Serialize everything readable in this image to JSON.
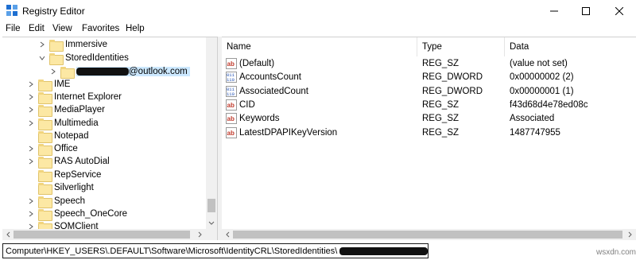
{
  "window": {
    "title": "Registry Editor",
    "minimize_icon": "minimize-icon",
    "maximize_icon": "maximize-icon",
    "close_icon": "close-icon"
  },
  "menu": [
    "File",
    "Edit",
    "View",
    "Favorites",
    "Help"
  ],
  "tree": {
    "items": [
      {
        "label": "Immersive",
        "expander": "collapsed"
      },
      {
        "label": "StoredIdentities",
        "expander": "expanded"
      },
      {
        "label": "@outlook.com",
        "expander": "collapsed",
        "selected": true,
        "redacted_prefix": true
      },
      {
        "label": "IME",
        "expander": "collapsed"
      },
      {
        "label": "Internet Explorer",
        "expander": "collapsed"
      },
      {
        "label": "MediaPlayer",
        "expander": "collapsed"
      },
      {
        "label": "Multimedia",
        "expander": "collapsed"
      },
      {
        "label": "Notepad",
        "expander": "none"
      },
      {
        "label": "Office",
        "expander": "collapsed"
      },
      {
        "label": "RAS AutoDial",
        "expander": "collapsed"
      },
      {
        "label": "RepService",
        "expander": "none"
      },
      {
        "label": "Silverlight",
        "expander": "none"
      },
      {
        "label": "Speech",
        "expander": "collapsed"
      },
      {
        "label": "Speech_OneCore",
        "expander": "collapsed"
      },
      {
        "label": "SQMClient",
        "expander": "collapsed"
      }
    ]
  },
  "values": {
    "headers": [
      "Name",
      "Type",
      "Data"
    ],
    "rows": [
      {
        "icon": "string-value-icon",
        "name": "(Default)",
        "type": "REG_SZ",
        "data": "(value not set)"
      },
      {
        "icon": "dword-value-icon",
        "name": "AccountsCount",
        "type": "REG_DWORD",
        "data": "0x00000002 (2)"
      },
      {
        "icon": "dword-value-icon",
        "name": "AssociatedCount",
        "type": "REG_DWORD",
        "data": "0x00000001 (1)"
      },
      {
        "icon": "string-value-icon",
        "name": "CID",
        "type": "REG_SZ",
        "data": "f43d68d4e78ed08c"
      },
      {
        "icon": "string-value-icon",
        "name": "Keywords",
        "type": "REG_SZ",
        "data": "Associated"
      },
      {
        "icon": "string-value-icon",
        "name": "LatestDPAPIKeyVersion",
        "type": "REG_SZ",
        "data": "1487747955"
      }
    ]
  },
  "status": {
    "path": "Computer\\HKEY_USERS\\.DEFAULT\\Software\\Microsoft\\IdentityCRL\\StoredIdentities\\"
  },
  "watermark": "wsxdn.com"
}
